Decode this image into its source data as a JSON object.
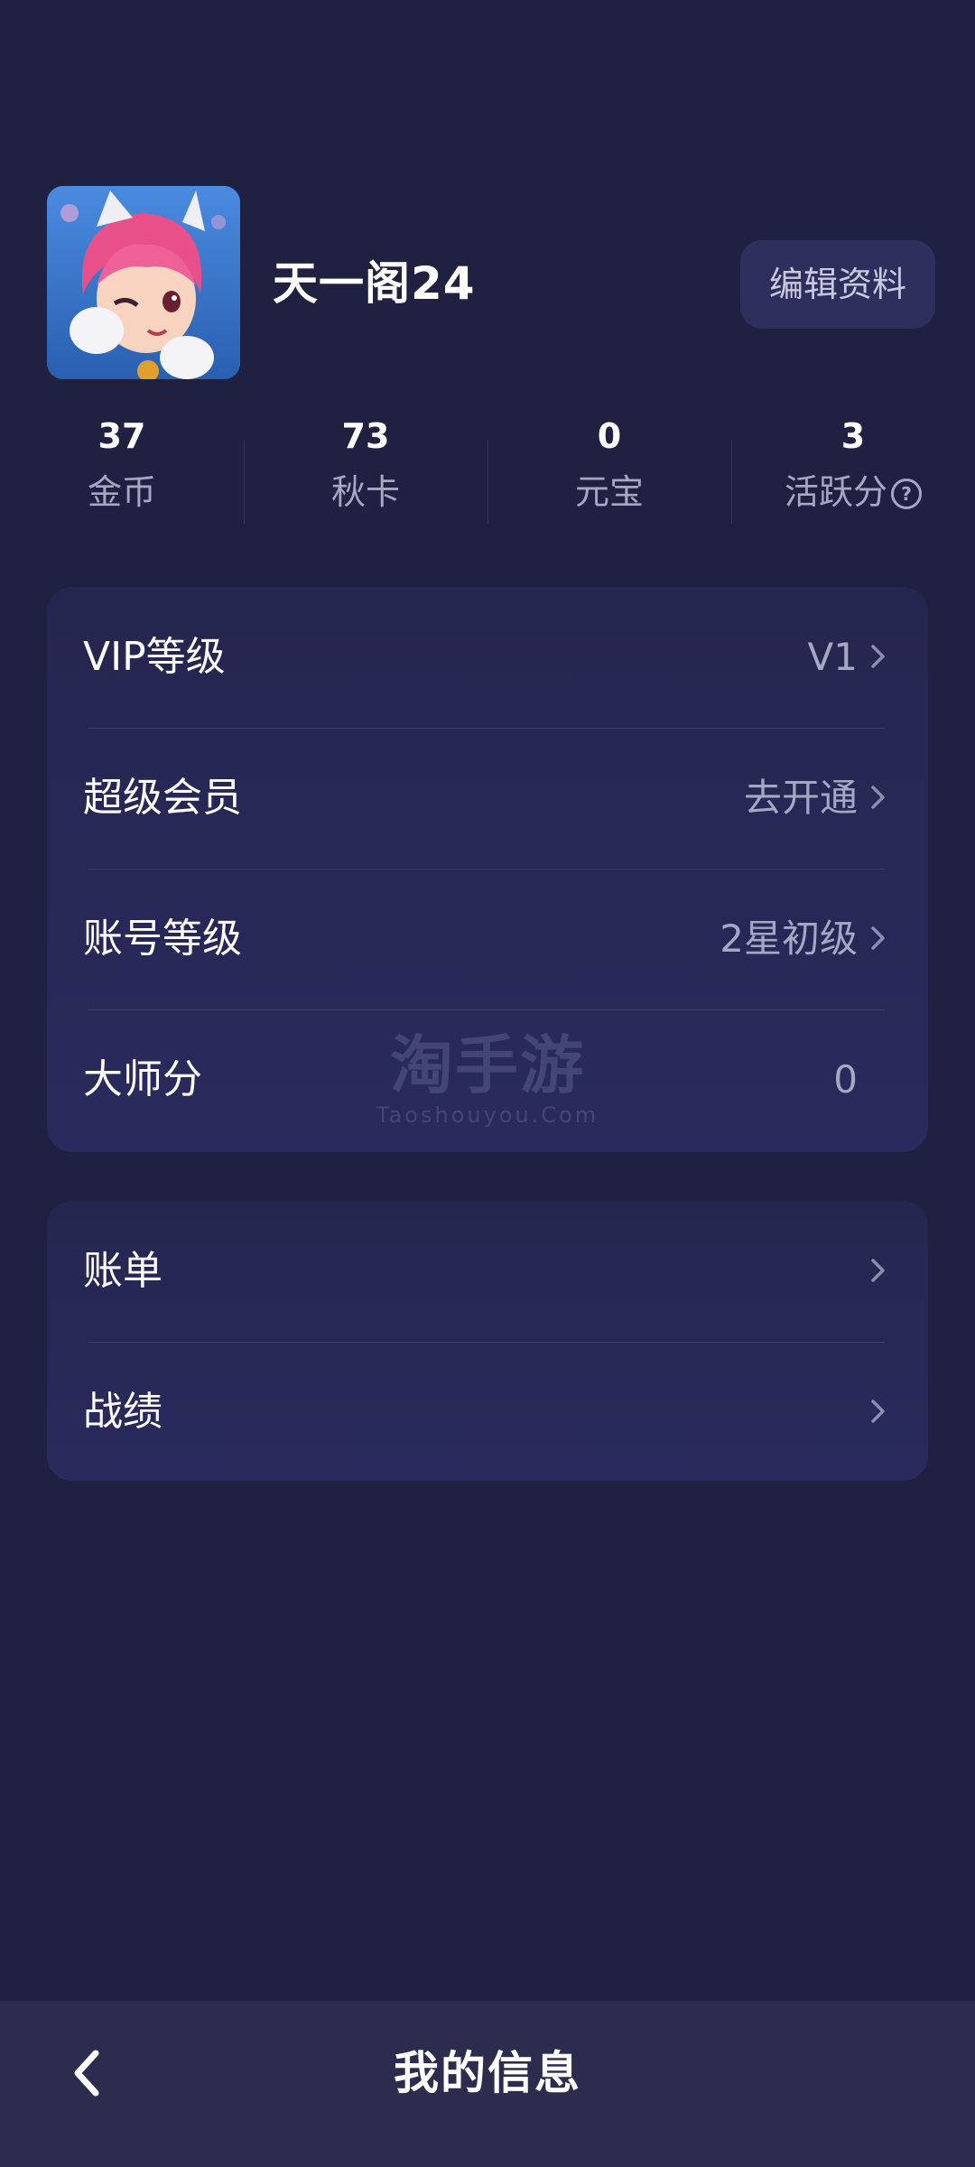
{
  "profile": {
    "username": "天一阁24",
    "edit_label": "编辑资料",
    "avatar_icon": "game-character-avatar"
  },
  "stats": [
    {
      "value": "37",
      "label": "金币"
    },
    {
      "value": "73",
      "label": "秋卡"
    },
    {
      "value": "0",
      "label": "元宝"
    },
    {
      "value": "3",
      "label": "活跃分",
      "help_icon": "question-circle-icon",
      "help_glyph": "?"
    }
  ],
  "card_levels": {
    "rows": [
      {
        "label": "VIP等级",
        "value": "V1",
        "has_arrow": true
      },
      {
        "label": "超级会员",
        "value": "去开通",
        "has_arrow": true
      },
      {
        "label": "账号等级",
        "value": "2星初级",
        "has_arrow": true
      },
      {
        "label": "大师分",
        "value": "0",
        "has_arrow": false
      }
    ]
  },
  "card_records": {
    "rows": [
      {
        "label": "账单",
        "has_arrow": true
      },
      {
        "label": "战绩",
        "has_arrow": true
      }
    ]
  },
  "watermark": {
    "main": "淘手游",
    "sub": "Taoshouyou.Com"
  },
  "nav": {
    "title": "我的信息",
    "back_icon": "back-arrow-icon"
  },
  "colors": {
    "background": "#202140",
    "card": "#272858",
    "bottom_bar": "#2b2c4e",
    "secondary_text": "#a6a7c3"
  }
}
